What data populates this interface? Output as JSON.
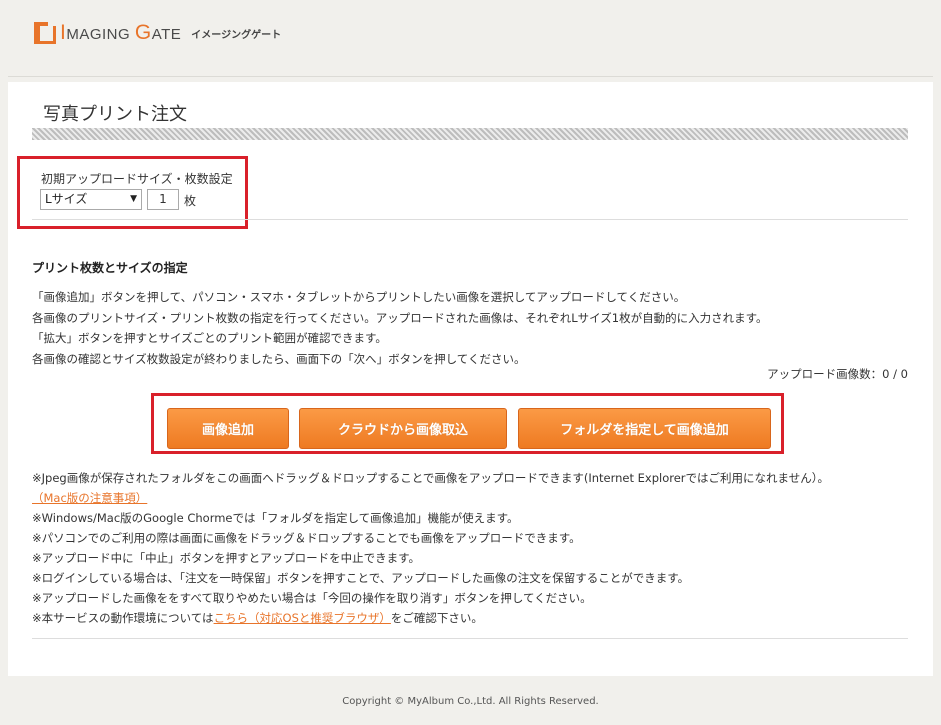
{
  "header": {
    "logo_first": "MAGING",
    "logo_first_cap": "I",
    "logo_second_cap": "G",
    "logo_second": "ATE",
    "logo_kana": "イメージングゲート"
  },
  "page_title": "写真プリント注文",
  "init_settings": {
    "label": "初期アップロードサイズ・枚数設定",
    "size_value": "Lサイズ",
    "qty_value": "1",
    "qty_unit": "枚"
  },
  "section": {
    "title": "プリント枚数とサイズの指定",
    "lines": [
      "「画像追加」ボタンを押して、パソコン・スマホ・タブレットからプリントしたい画像を選択してアップロードしてください。",
      "各画像のプリントサイズ・プリント枚数の指定を行ってください。アップロードされた画像は、それぞれLサイズ1枚が自動的に入力されます。",
      "「拡大」ボタンを押すとサイズごとのプリント範囲が確認できます。",
      "各画像の確認とサイズ枚数設定が終わりましたら、画面下の「次へ」ボタンを押してください。"
    ],
    "upload_count": "アップロード画像数：0 / 0"
  },
  "buttons": {
    "add_image": "画像追加",
    "cloud_import": "クラウドから画像取込",
    "folder_add": "フォルダを指定して画像追加"
  },
  "notes": {
    "n1": "※Jpeg画像が保存されたフォルダをこの画面へドラッグ＆ドロップすることで画像をアップロードできます(Internet Explorerではご利用になれません）。",
    "mac_link": "（Mac版の注意事項）",
    "n2": "※Windows/Mac版のGoogle Chormeでは「フォルダを指定して画像追加」機能が使えます。",
    "n3": "※パソコンでのご利用の際は画面に画像をドラッグ＆ドロップすることでも画像をアップロードできます。",
    "n4": "※アップロード中に「中止」ボタンを押すとアップロードを中止できます。",
    "n5": "※ログインしている場合は、「注文を一時保留」ボタンを押すことで、アップロードした画像の注文を保留することができます。",
    "n6": "※アップロードした画像ををすべて取りやめたい場合は「今回の操作を取り消す」ボタンを押してください。",
    "n7_pre": "※本サービスの動作環境については",
    "n7_link": "こちら（対応OSと推奨ブラウザ）",
    "n7_post": "をご確認下さい。"
  },
  "footer": "Copyright © MyAlbum Co.,Ltd. All Rights Reserved.",
  "colors": {
    "accent": "#e8742a",
    "highlight": "#d9202a",
    "button": "#f5892f"
  }
}
